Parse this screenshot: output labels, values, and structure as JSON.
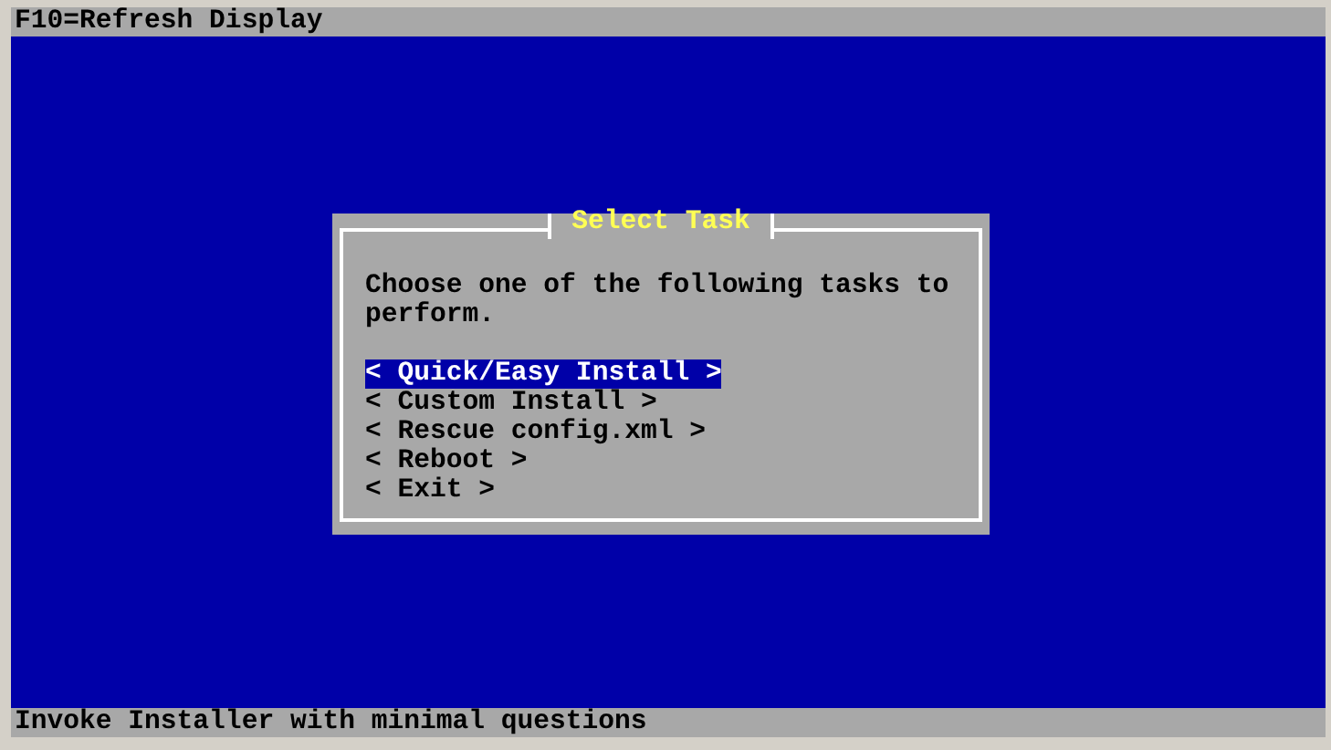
{
  "top_bar": {
    "text": "F10=Refresh Display"
  },
  "dialog": {
    "title": "Select Task",
    "prompt": "Choose one of the following tasks to perform.",
    "items": [
      {
        "label": "< Quick/Easy Install >",
        "selected": true
      },
      {
        "label": "< Custom Install >",
        "selected": false
      },
      {
        "label": "< Rescue config.xml >",
        "selected": false
      },
      {
        "label": "< Reboot >",
        "selected": false
      },
      {
        "label": "< Exit >",
        "selected": false
      }
    ]
  },
  "status_bar": {
    "text": "Invoke Installer with minimal questions"
  }
}
